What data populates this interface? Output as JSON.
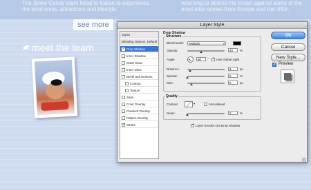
{
  "page": {
    "text_left": "The Snow Candy team head to Italian to experience the local snow, attractions and lifestyle.",
    "text_right": "returning to defend his crown against some of the most elite names from Europe and the USA.",
    "see_more": "see more",
    "meet_team": "meet the team"
  },
  "dialog": {
    "title": "Layer Style",
    "styles_header": "Styles",
    "blending_options": "Blending Options: Default",
    "effects": [
      {
        "label": "Drop Shadow",
        "checked": true,
        "selected": true,
        "indent": false
      },
      {
        "label": "Inner Shadow",
        "checked": false,
        "selected": false,
        "indent": false
      },
      {
        "label": "Outer Glow",
        "checked": false,
        "selected": false,
        "indent": false
      },
      {
        "label": "Inner Glow",
        "checked": false,
        "selected": false,
        "indent": false
      },
      {
        "label": "Bevel and Emboss",
        "checked": false,
        "selected": false,
        "indent": false
      },
      {
        "label": "Contour",
        "checked": false,
        "selected": false,
        "indent": true
      },
      {
        "label": "Texture",
        "checked": false,
        "selected": false,
        "indent": true
      },
      {
        "label": "Satin",
        "checked": false,
        "selected": false,
        "indent": false
      },
      {
        "label": "Color Overlay",
        "checked": false,
        "selected": false,
        "indent": false
      },
      {
        "label": "Gradient Overlay",
        "checked": false,
        "selected": false,
        "indent": false
      },
      {
        "label": "Pattern Overlay",
        "checked": false,
        "selected": false,
        "indent": false
      },
      {
        "label": "Stroke",
        "checked": true,
        "selected": false,
        "indent": false
      }
    ],
    "drop_shadow": {
      "section_title": "Drop Shadow",
      "structure_title": "Structure",
      "blend_mode_label": "Blend Mode:",
      "blend_mode_value": "Multiply",
      "shadow_color": "#000000",
      "opacity_label": "Opacity:",
      "opacity_value": "40",
      "angle_label": "Angle:",
      "angle_value": "90",
      "use_global_light_label": "Use Global Light",
      "use_global_light_checked": true,
      "distance_label": "Distance:",
      "distance_value": "3",
      "spread_label": "Spread:",
      "spread_value": "0",
      "size_label": "Size:",
      "size_value": "8",
      "px_unit": "px",
      "percent_unit": "%",
      "degree_unit": "°",
      "quality_title": "Quality",
      "contour_label": "Contour:",
      "anti_aliased_label": "Anti-aliased",
      "anti_aliased_checked": false,
      "noise_label": "Noise:",
      "noise_value": "0",
      "knocks_out_label": "Layer Knocks Out Drop Shadow",
      "knocks_out_checked": true
    },
    "buttons": {
      "ok": "OK",
      "cancel": "Cancel",
      "new_style": "New Style...",
      "preview_label": "Preview",
      "preview_checked": true
    }
  }
}
